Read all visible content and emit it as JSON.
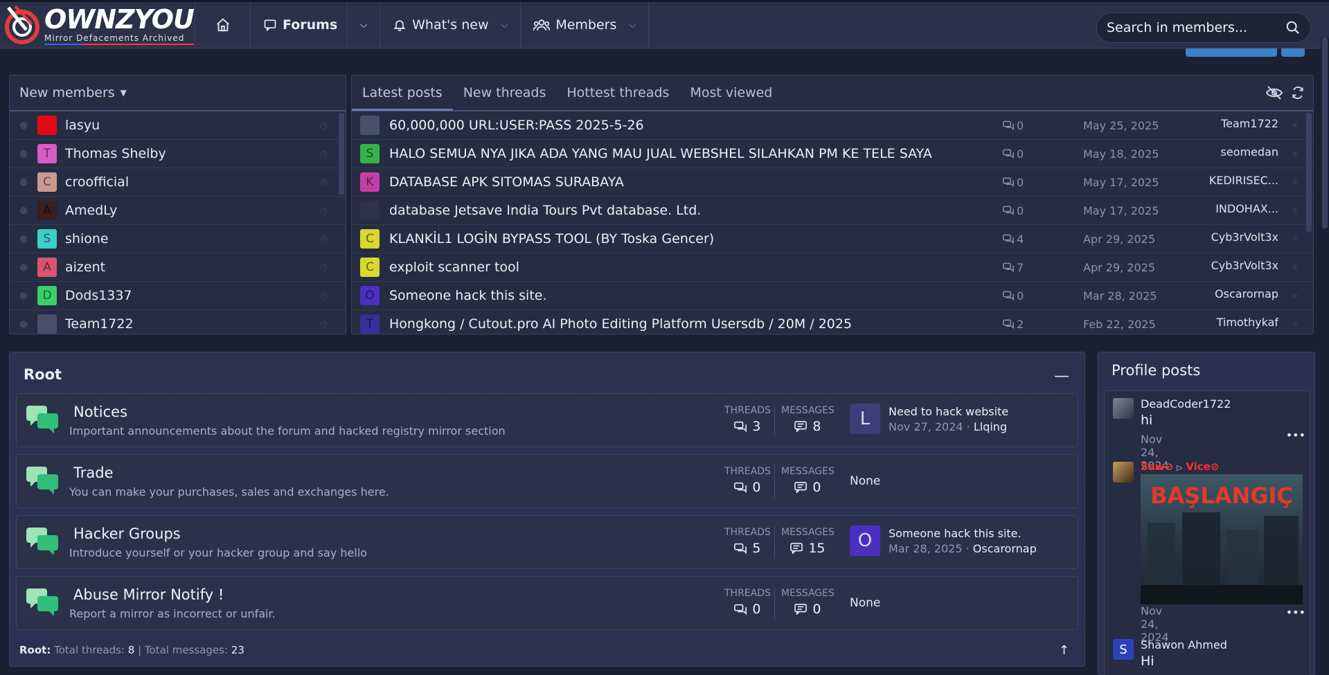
{
  "site": {
    "logo_title": "OWNZYOU",
    "logo_sub": "Mirror Defacements Archived"
  },
  "nav": {
    "forums": "Forums",
    "whats_new": "What's new",
    "members": "Members"
  },
  "search": {
    "placeholder": "Search in members..."
  },
  "new_members": {
    "heading": "New members",
    "items": [
      {
        "name": "lasyu",
        "initial": "",
        "color": "#e30a17"
      },
      {
        "name": "Thomas Shelby",
        "initial": "T",
        "color": "#d65cc4"
      },
      {
        "name": "croofficial",
        "initial": "C",
        "color": "#c99a8f"
      },
      {
        "name": "AmedLy",
        "initial": "A",
        "color": "#3a1f1f"
      },
      {
        "name": "shione",
        "initial": "S",
        "color": "#3ccfc7"
      },
      {
        "name": "aizent",
        "initial": "A",
        "color": "#d9556e"
      },
      {
        "name": "Dods1337",
        "initial": "D",
        "color": "#3bcf6b"
      },
      {
        "name": "Team1722",
        "initial": "",
        "color": "#4a4f6a"
      }
    ]
  },
  "posts_tabs": {
    "latest": "Latest posts",
    "new_threads": "New threads",
    "hottest": "Hottest threads",
    "most_viewed": "Most viewed"
  },
  "latest_posts": [
    {
      "title": "60,000,000 URL:USER:PASS 2025-5-26",
      "replies": "0",
      "date": "May 25, 2025",
      "author": "Team1722",
      "initial": "",
      "color": "#4a4f6a"
    },
    {
      "title": "HALO SEMUA NYA JIKA ADA YANG MAU JUAL WEBSHEL SILAHKAN PM KE TELE SAYA",
      "replies": "0",
      "date": "May 18, 2025",
      "author": "seomedan",
      "initial": "S",
      "color": "#36b34a"
    },
    {
      "title": "DATABASE APK SITOMAS SURABAYA",
      "replies": "0",
      "date": "May 17, 2025",
      "author": "KEDIRISEC...",
      "initial": "K",
      "color": "#c23fa6"
    },
    {
      "title": "database Jetsave India Tours Pvt database. Ltd.",
      "replies": "0",
      "date": "May 17, 2025",
      "author": "INDOHAX...",
      "initial": "",
      "color": "#2e3148"
    },
    {
      "title": "KLANKİL1 LOGİN BYPASS TOOL (BY Toska Gencer)",
      "replies": "4",
      "date": "Apr 29, 2025",
      "author": "Cyb3rVolt3x",
      "initial": "C",
      "color": "#d6d92e"
    },
    {
      "title": "exploit scanner tool",
      "replies": "7",
      "date": "Apr 29, 2025",
      "author": "Cyb3rVolt3x",
      "initial": "C",
      "color": "#d6d92e"
    },
    {
      "title": "Someone hack this site.",
      "replies": "0",
      "date": "Mar 28, 2025",
      "author": "Oscarornap",
      "initial": "O",
      "color": "#4b2ec2"
    },
    {
      "title": "Hongkong / Cutout.pro AI Photo Editing Platform Usersdb / 20M / 2025",
      "replies": "2",
      "date": "Feb 22, 2025",
      "author": "Timothykaf",
      "initial": "T",
      "color": "#35309a"
    }
  ],
  "root": {
    "title": "Root",
    "threads_label": "THREADS",
    "messages_label": "MESSAGES",
    "nodes": [
      {
        "title": "Notices",
        "desc": "Important announcements about the forum and hacked registry mirror section",
        "threads": "3",
        "messages": "8",
        "latest_title": "Need to hack website",
        "latest_date": "Nov 27, 2024 ·",
        "latest_user": "Llqing",
        "latest_initial": "L",
        "latest_color": "#3a3f7a"
      },
      {
        "title": "Trade",
        "desc": "You can make your purchases, sales and exchanges here.",
        "threads": "0",
        "messages": "0",
        "none": "None"
      },
      {
        "title": "Hacker Groups",
        "desc": "Introduce yourself or your hacker group and say hello",
        "threads": "5",
        "messages": "15",
        "latest_title": "Someone hack this site.",
        "latest_date": "Mar 28, 2025 ·",
        "latest_user": "Oscarornap",
        "latest_initial": "O",
        "latest_color": "#4b2ec2"
      },
      {
        "title": "Abuse Mirror Notify !",
        "desc": "Report a mirror as incorrect or unfair.",
        "threads": "0",
        "messages": "0",
        "none": "None"
      }
    ],
    "footer_label": "Root:",
    "footer_threads_label": "Total threads:",
    "footer_threads": "8",
    "footer_messages_label": "Total messages:",
    "footer_messages": "23"
  },
  "profile_posts": {
    "title": "Profile posts",
    "items": [
      {
        "user": "DeadCoder1722",
        "text": "hi",
        "date": "Nov 24, 2024"
      },
      {
        "user": "Saw",
        "target": "Vice",
        "image_text": "BAŞLANGIÇ",
        "date": "Nov 24, 2024"
      },
      {
        "user": "Shawon Ahmed",
        "initial": "S",
        "text": "Hi"
      }
    ]
  },
  "colors": {
    "accent": "#3a84c9",
    "background": "#1b2133",
    "panel": "#262c42"
  }
}
